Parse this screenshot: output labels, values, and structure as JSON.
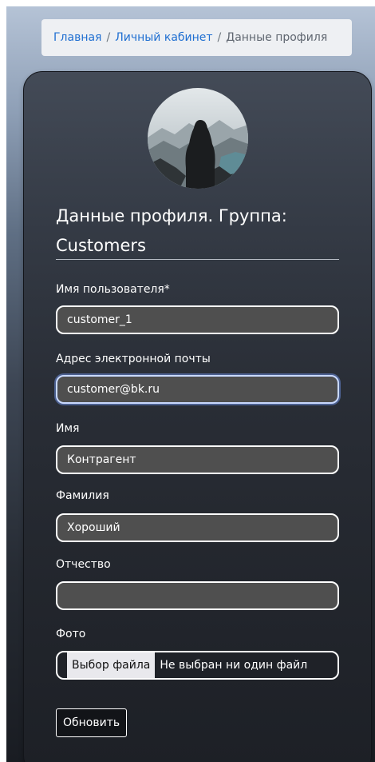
{
  "breadcrumb": {
    "items": [
      {
        "label": "Главная"
      },
      {
        "label": "Личный кабинет"
      }
    ],
    "separator": "/",
    "current": "Данные профиля"
  },
  "profile": {
    "avatar_icon": "profile-photo-person-on-mountain",
    "title": "Данные профиля. Группа: Customers"
  },
  "form": {
    "username": {
      "label": "Имя пользователя*",
      "value": "customer_1"
    },
    "email": {
      "label": "Адрес электронной почты",
      "value": "customer@bk.ru"
    },
    "first_name": {
      "label": "Имя",
      "value": "Контрагент"
    },
    "last_name": {
      "label": "Фамилия",
      "value": "Хороший"
    },
    "patronymic": {
      "label": "Отчество",
      "value": ""
    },
    "photo": {
      "label": "Фото",
      "button_label": "Выбор файла",
      "status": "Не выбран ни один файл"
    },
    "submit_label": "Обновить"
  },
  "colors": {
    "link": "#1f6fd1",
    "input_background": "#4f4f4f",
    "input_border": "#ffffff",
    "card_background": "#2b2f36"
  }
}
